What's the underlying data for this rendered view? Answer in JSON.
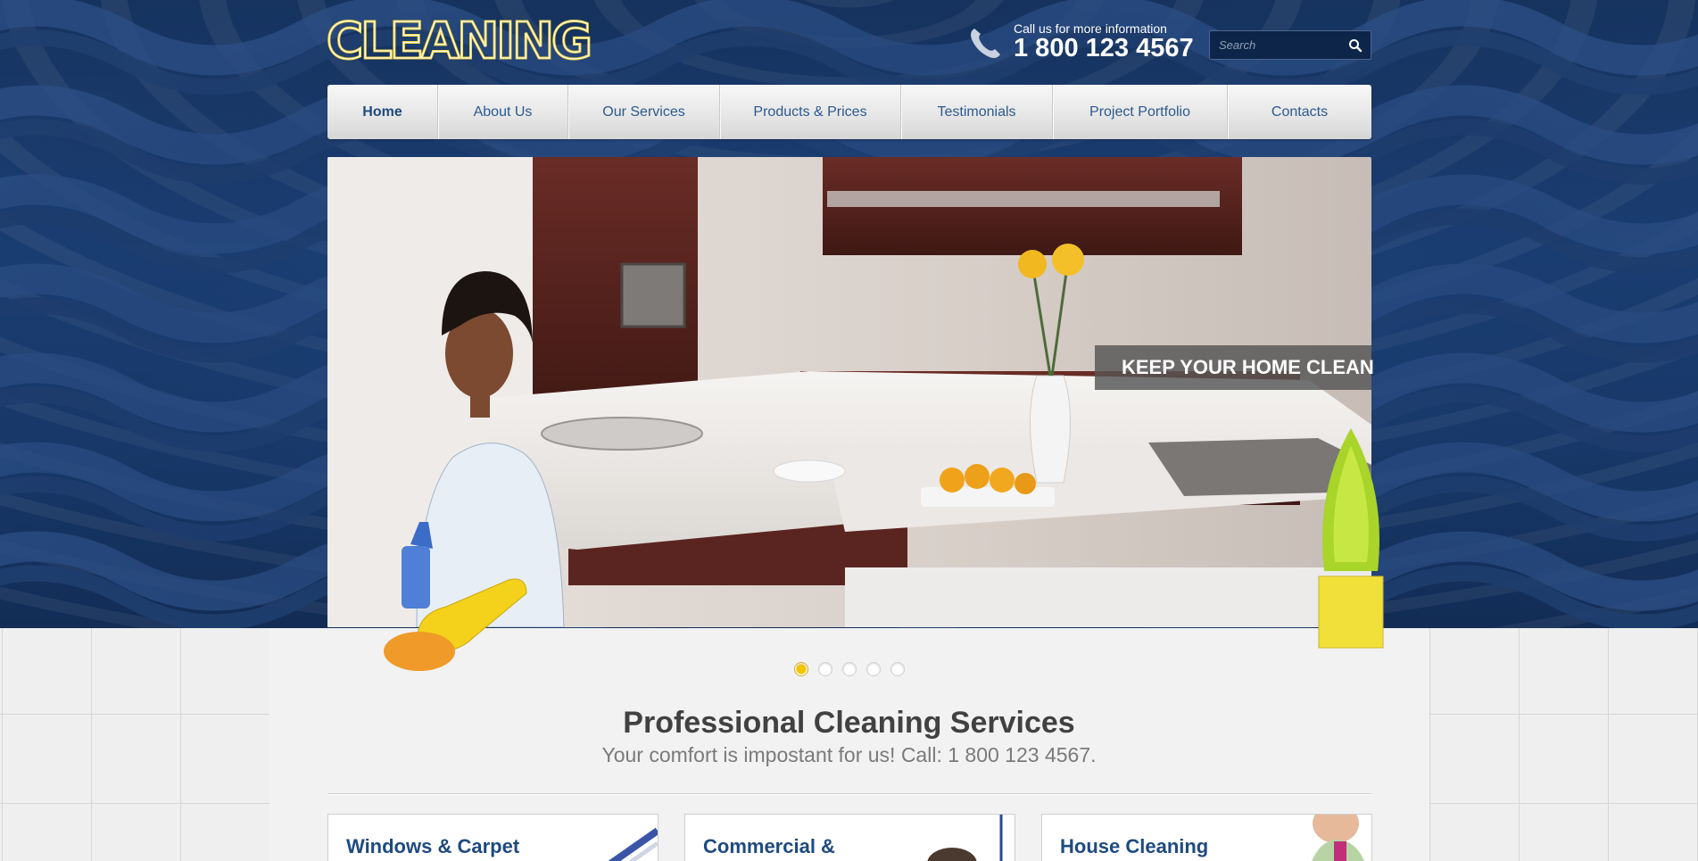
{
  "header": {
    "logo_text": "CLEANING",
    "phone_caption": "Call us for more information",
    "phone_number": "1 800 123 4567",
    "search": {
      "placeholder": "Search"
    }
  },
  "nav": {
    "items": [
      {
        "label": "Home",
        "active": true
      },
      {
        "label": "About Us"
      },
      {
        "label": "Our Services"
      },
      {
        "label": "Products & Prices"
      },
      {
        "label": "Testimonials"
      },
      {
        "label": "Project Portfolio"
      },
      {
        "label": "Contacts"
      }
    ]
  },
  "slider": {
    "caption": "KEEP YOUR HOME CLEAN",
    "slide_count": 5,
    "active_slide": 1
  },
  "intro": {
    "title": "Professional Cleaning Services",
    "subtitle": "Your comfort is impostant for us! Call: 1 800 123 4567."
  },
  "services": [
    {
      "title": "Windows & Carpet"
    },
    {
      "title": "Commercial &"
    },
    {
      "title": "House Cleaning"
    }
  ],
  "colors": {
    "accent_yellow": "#f5c400",
    "nav_text": "#2b5a8e",
    "heading_blue": "#1e4a80",
    "bg_navy": "#173868"
  },
  "icons": [
    "phone-icon",
    "search-icon"
  ]
}
